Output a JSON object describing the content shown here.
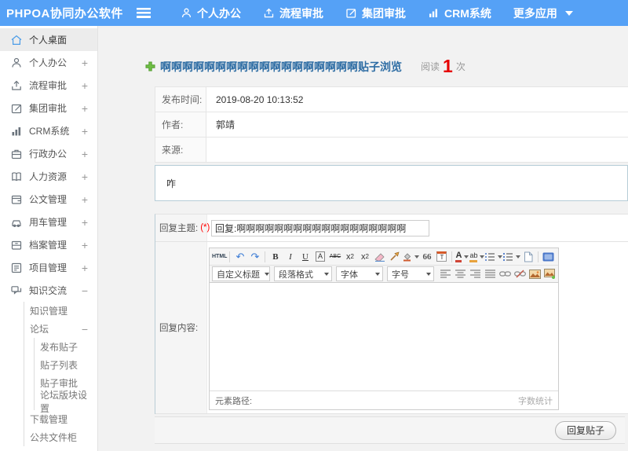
{
  "colors": {
    "topbar_blue": "#55a1f6",
    "title_blue": "#2e6da4",
    "read_count_red": "#e60000",
    "active_item_bg": "#ececec",
    "active_icon_blue": "#4a9ce8",
    "content_box_border": "#b6cdd7",
    "required_red": "#f00000"
  },
  "topbar": {
    "logo": "PHPOA协同办公软件",
    "nav": [
      {
        "label": "个人办公",
        "icon": "person-icon"
      },
      {
        "label": "流程审批",
        "icon": "upload-icon"
      },
      {
        "label": "集团审批",
        "icon": "edit-icon"
      },
      {
        "label": "CRM系统",
        "icon": "bar-chart-icon"
      },
      {
        "label": "更多应用",
        "icon": "caret-down-icon"
      }
    ]
  },
  "sidebar": {
    "items": [
      {
        "label": "个人桌面",
        "icon": "home-icon",
        "toggle": "",
        "active": true
      },
      {
        "label": "个人办公",
        "icon": "person-icon",
        "toggle": "+"
      },
      {
        "label": "流程审批",
        "icon": "upload-icon",
        "toggle": "+"
      },
      {
        "label": "集团审批",
        "icon": "edit-icon",
        "toggle": "+"
      },
      {
        "label": "CRM系统",
        "icon": "bar-chart-icon",
        "toggle": "+"
      },
      {
        "label": "行政办公",
        "icon": "briefcase-icon",
        "toggle": "+"
      },
      {
        "label": "人力资源",
        "icon": "book-icon",
        "toggle": "+"
      },
      {
        "label": "公文管理",
        "icon": "document-icon",
        "toggle": "+"
      },
      {
        "label": "用车管理",
        "icon": "car-icon",
        "toggle": "+"
      },
      {
        "label": "档案管理",
        "icon": "archive-icon",
        "toggle": "+"
      },
      {
        "label": "项目管理",
        "icon": "project-icon",
        "toggle": "+"
      },
      {
        "label": "知识交流",
        "icon": "chat-icon",
        "toggle": "−"
      }
    ],
    "sub": [
      {
        "label": "知识管理",
        "toggle": ""
      },
      {
        "label": "论坛",
        "toggle": "−"
      },
      {
        "label": "发布贴子",
        "toggle": ""
      },
      {
        "label": "贴子列表",
        "toggle": ""
      },
      {
        "label": "贴子审批",
        "toggle": ""
      },
      {
        "label": "论坛版块设置",
        "toggle": ""
      },
      {
        "label": "下载管理",
        "toggle": ""
      },
      {
        "label": "公共文件柜",
        "toggle": ""
      }
    ]
  },
  "title": {
    "text": "啊啊啊啊啊啊啊啊啊啊啊啊啊啊啊啊啊啊贴子浏览",
    "read_label": "阅读",
    "read_count": "1",
    "read_suffix": "次"
  },
  "info": {
    "rows": [
      {
        "label": "发布时间:",
        "value": "2019-08-20 10:13:52"
      },
      {
        "label": "作者:",
        "value": "郭靖"
      },
      {
        "label": "来源:",
        "value": ""
      }
    ],
    "content": "咋"
  },
  "reply": {
    "subject_label": "回复主题:",
    "required": "(*)",
    "subject_value": "回复:啊啊啊啊啊啊啊啊啊啊啊啊啊啊啊啊啊啊",
    "content_label": "回复内容:"
  },
  "editor": {
    "toolbar1": {
      "html": "HTML",
      "undo": "↶",
      "redo": "↷",
      "bold": "B",
      "italic": "I",
      "underline": "U",
      "box_a": "A",
      "strike": "ABC",
      "sup_base": "x",
      "sup_exp": "2",
      "sub_base": "x",
      "sub_exp": "2",
      "quote": "66",
      "date_t": "T",
      "font_color": "A",
      "highlight": "ab"
    },
    "dropdowns": [
      "自定义标题",
      "段落格式",
      "字体",
      "字号"
    ],
    "status": {
      "path": "元素路径:",
      "count": "字数统计"
    },
    "icon_names": [
      "remove-format-icon",
      "format-painter-icon",
      "fill-color-icon",
      "ordered-list-icon",
      "unordered-list-icon",
      "new-page-icon",
      "fullscreen-icon",
      "align-left-icon",
      "align-center-icon",
      "align-right-icon",
      "align-justify-icon",
      "link-icon",
      "unlink-icon",
      "image-icon",
      "multi-image-icon",
      "media-icon",
      "table-icon"
    ]
  },
  "footer": {
    "submit": "回复贴子"
  }
}
